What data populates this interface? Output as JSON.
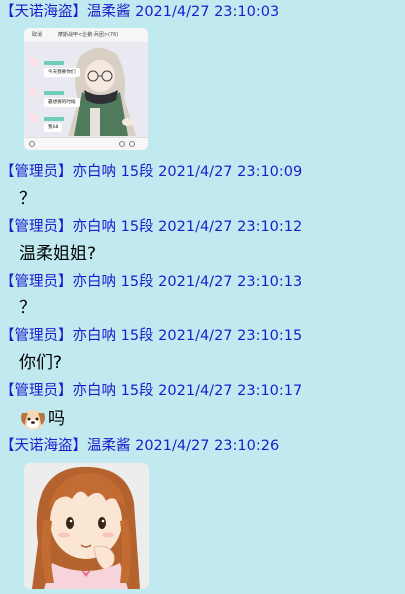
{
  "messages": [
    {
      "sender": "【天诺海盗】温柔酱 2021/4/27 23:10:03"
    },
    {
      "sender": "【管理员】亦白呐 15段 2021/4/27 23:10:09",
      "text": "？"
    },
    {
      "sender": "【管理员】亦白呐 15段 2021/4/27 23:10:12",
      "text": "温柔姐姐?"
    },
    {
      "sender": "【管理员】亦白呐 15段 2021/4/27 23:10:13",
      "text": "？"
    },
    {
      "sender": "【管理员】亦白呐 15段 2021/4/27 23:10:15",
      "text": "你们?"
    },
    {
      "sender": "【管理员】亦白呐 15段 2021/4/27 23:10:17",
      "text": "吗",
      "emoji": "dog-face-emoji"
    },
    {
      "sender": "【天诺海盗】温柔酱 2021/4/27 23:10:26"
    }
  ],
  "screenshot_image": {
    "cancel": "取消",
    "title": "摩斯战甲<企鹅·兵团>(76)",
    "bubbles": [
      "今天我要你们",
      "最想要的时候",
      "我S8"
    ]
  },
  "colors": {
    "background": "#c1eaf0",
    "sender": "#1c1ccc",
    "text": "#000000"
  }
}
